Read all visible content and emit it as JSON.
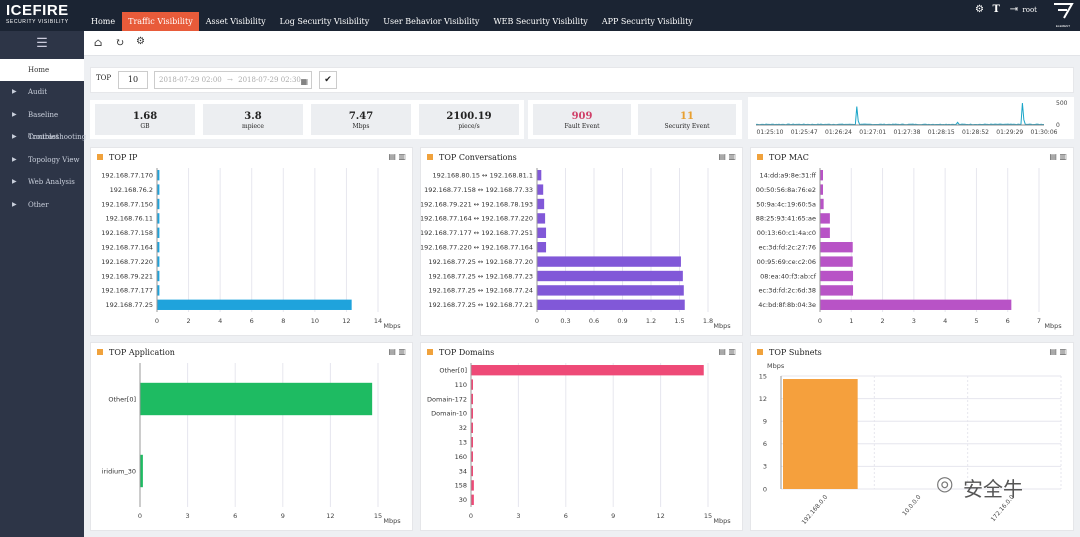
{
  "brand": {
    "name": "ICEFIRE",
    "tagline": "SECURITY   VISIBILITY"
  },
  "nav": {
    "tabs": [
      "Home",
      "Traffic Visibility",
      "Asset Visibility",
      "Log Security Visibility",
      "User Behavior Visibility",
      "WEB Security Visibility",
      "APP Security Visibility"
    ],
    "active": 1
  },
  "header": {
    "user": "root",
    "right_logo": "ELEMENT"
  },
  "sidebar": {
    "home": "Home",
    "items": [
      "Audit",
      "Baseline Contrast",
      "Troubleshooting",
      "Topology View",
      "Web Analysis",
      "Other"
    ]
  },
  "filter": {
    "top_label": "TOP",
    "top_value": "10",
    "start": "2018-07-29 02:00",
    "sep": "→",
    "end": "2018-07-29 02:30"
  },
  "stats": [
    {
      "value": "1.68",
      "unit": "GB"
    },
    {
      "value": "3.8",
      "unit": "mpiece"
    },
    {
      "value": "7.47",
      "unit": "Mbps"
    },
    {
      "value": "2100.19",
      "unit": "piece/s"
    }
  ],
  "events": [
    {
      "value": "909",
      "label": "Fault Event",
      "color": "#d0426a"
    },
    {
      "value": "11",
      "label": "Security Event",
      "color": "#e8a030"
    }
  ],
  "watermark": "安全牛",
  "chart_data": [
    {
      "id": "top_ip",
      "type": "bar",
      "title": "TOP IP",
      "color": "#1fa3dc",
      "xlabel": "Mbps",
      "xlim": [
        0,
        14
      ],
      "ticks": [
        0,
        2,
        4,
        6,
        8,
        10,
        12,
        14
      ],
      "categories": [
        "192.168.77.170",
        "192.168.76.2",
        "192.168.77.150",
        "192.168.76.11",
        "192.168.77.158",
        "192.168.77.164",
        "192.168.77.220",
        "192.168.79.221",
        "192.168.77.177",
        "192.168.77.25"
      ],
      "values": [
        0.12,
        0.12,
        0.12,
        0.12,
        0.12,
        0.12,
        0.12,
        0.12,
        0.12,
        12.3
      ]
    },
    {
      "id": "top_conv",
      "type": "bar",
      "title": "TOP Conversations",
      "color": "#8158d8",
      "xlabel": "Mbps",
      "xlim": [
        0,
        1.8
      ],
      "ticks": [
        0,
        0.3,
        0.6,
        0.9,
        1.2,
        1.5,
        1.8
      ],
      "categories": [
        "192.168.80.15 ↔ 192.168.81.1",
        "192.168.77.158 ↔ 192.168.77.33",
        "192.168.79.221 ↔ 192.168.78.193",
        "192.168.77.164 ↔ 192.168.77.220",
        "192.168.77.177 ↔ 192.168.77.251",
        "192.168.77.220 ↔ 192.168.77.164",
        "192.168.77.25 ↔ 192.168.77.20",
        "192.168.77.25 ↔ 192.168.77.23",
        "192.168.77.25 ↔ 192.168.77.24",
        "192.168.77.25 ↔ 192.168.77.21"
      ],
      "values": [
        0.04,
        0.06,
        0.07,
        0.08,
        0.09,
        0.09,
        1.51,
        1.53,
        1.54,
        1.55
      ]
    },
    {
      "id": "top_mac",
      "type": "bar",
      "title": "TOP MAC",
      "color": "#b853c6",
      "xlabel": "Mbps",
      "xlim": [
        0,
        7
      ],
      "ticks": [
        0,
        1,
        2,
        3,
        4,
        5,
        6,
        7
      ],
      "categories": [
        "14:dd:a9:8e:31:ff",
        "00:50:56:8a:76:e2",
        "50:9a:4c:19:60:5a",
        "88:25:93:41:65:ae",
        "00:13:60:c1:4a:c0",
        "ec:3d:fd:2c:27:76",
        "00:95:69:ce:c2:06",
        "08:ea:40:f3:ab:cf",
        "ec:3d:fd:2c:6d:38",
        "4c:bd:8f:8b:04:3e"
      ],
      "values": [
        0.08,
        0.08,
        0.1,
        0.3,
        0.3,
        1.03,
        1.03,
        1.04,
        1.04,
        6.1
      ]
    },
    {
      "id": "top_app",
      "type": "bar",
      "title": "TOP Application",
      "color": "#1ebb62",
      "xlabel": "Mbps",
      "xlim": [
        0,
        15
      ],
      "ticks": [
        0,
        3,
        6,
        9,
        12,
        15
      ],
      "categories": [
        "Other[0]",
        "iridium_30"
      ],
      "values": [
        14.6,
        0.15
      ]
    },
    {
      "id": "top_domains",
      "type": "bar",
      "title": "TOP Domains",
      "color": "#ee4a77",
      "xlabel": "Mbps",
      "xlim": [
        0,
        15
      ],
      "ticks": [
        0,
        3,
        6,
        9,
        12,
        15
      ],
      "categories": [
        "Other[0]",
        "110",
        "Domain-172",
        "Domain-10",
        "32",
        "13",
        "160",
        "34",
        "158",
        "30"
      ],
      "values": [
        14.7,
        0.02,
        0.02,
        0.02,
        0.02,
        0.02,
        0.02,
        0.02,
        0.15,
        0.15
      ]
    },
    {
      "id": "top_subnets",
      "type": "column",
      "title": "TOP Subnets",
      "color": "#f5a03d",
      "ylabel": "Mbps",
      "ylim": [
        0,
        15
      ],
      "ticks": [
        0,
        3,
        6,
        9,
        12,
        15
      ],
      "categories": [
        "192.168.0.0",
        "10.0.0.0",
        "172.16.0.0"
      ],
      "values": [
        14.6,
        0,
        0
      ]
    },
    {
      "id": "trend",
      "type": "line",
      "color": "#1aa5c8",
      "ylim": [
        0,
        500
      ],
      "yticks": [
        0,
        500
      ],
      "x": [
        "01:25:10",
        "01:25:47",
        "01:26:24",
        "01:27:01",
        "01:27:38",
        "01:28:15",
        "01:28:52",
        "01:29:29",
        "01:30:06"
      ]
    }
  ]
}
